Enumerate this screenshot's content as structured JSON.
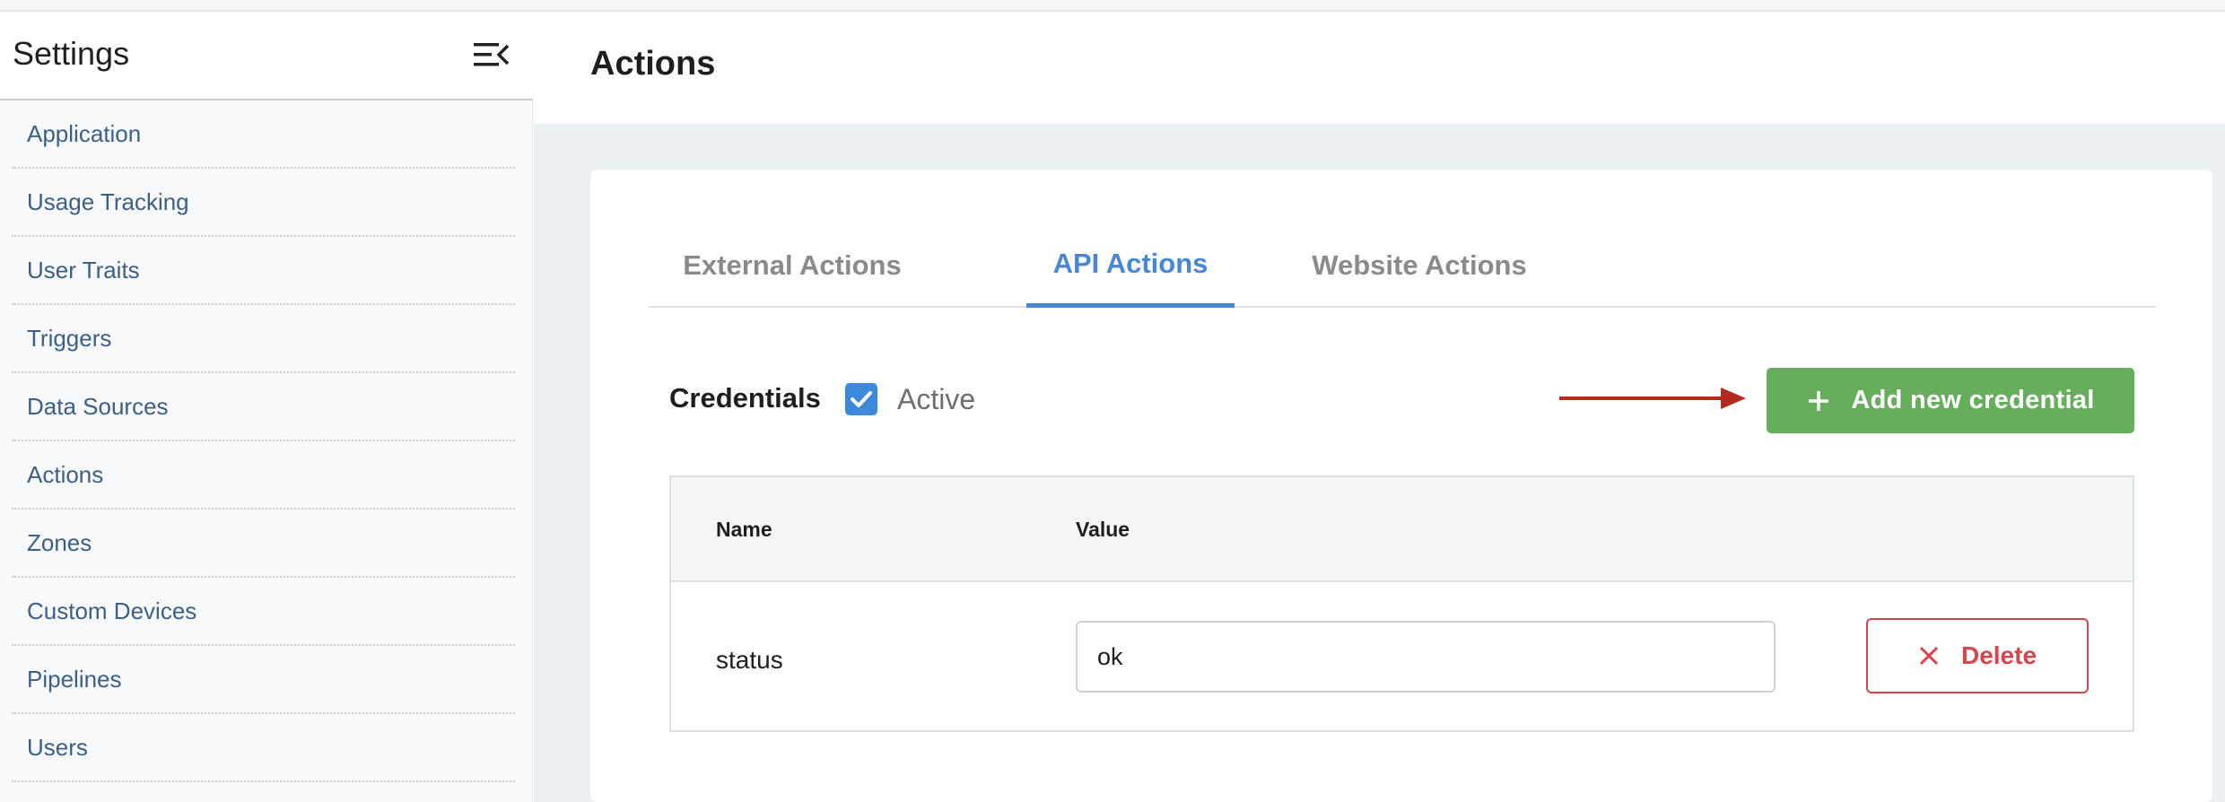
{
  "sidebar": {
    "title": "Settings",
    "collapse_icon": "collapse-menu-icon",
    "items": [
      {
        "label": "Application"
      },
      {
        "label": "Usage Tracking"
      },
      {
        "label": "User Traits"
      },
      {
        "label": "Triggers"
      },
      {
        "label": "Data Sources"
      },
      {
        "label": "Actions"
      },
      {
        "label": "Zones"
      },
      {
        "label": "Custom Devices"
      },
      {
        "label": "Pipelines"
      },
      {
        "label": "Users"
      }
    ]
  },
  "header": {
    "title": "Actions"
  },
  "tabs": [
    {
      "label": "External Actions",
      "active": false
    },
    {
      "label": "API Actions",
      "active": true
    },
    {
      "label": "Website Actions",
      "active": false
    }
  ],
  "credentials": {
    "label": "Credentials",
    "active_label": "Active",
    "active_checked": true,
    "add_button_label": "Add new credential",
    "add_button_icon": "plus-icon"
  },
  "table": {
    "columns": [
      "Name",
      "Value"
    ],
    "rows": [
      {
        "name": "status",
        "value": "ok",
        "delete_label": "Delete"
      }
    ]
  },
  "colors": {
    "accent": "#4a86d8",
    "add_button": "#66ae5b",
    "delete": "#d9444b",
    "annotation_arrow": "#b42a1e"
  }
}
